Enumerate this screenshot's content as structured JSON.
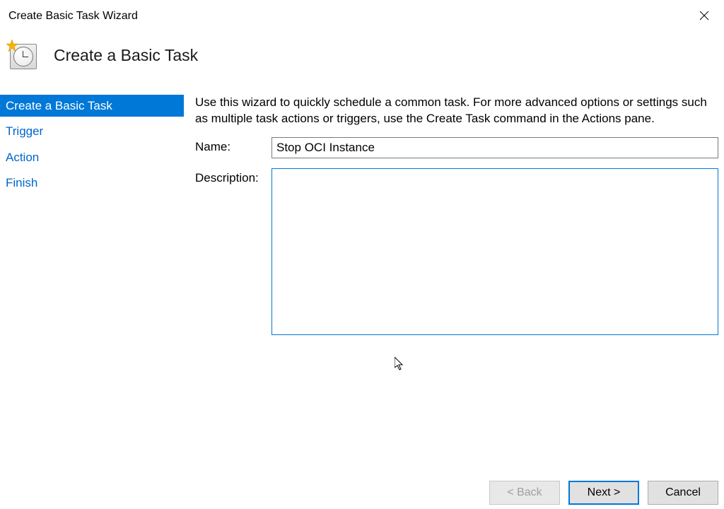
{
  "window": {
    "title": "Create Basic Task Wizard"
  },
  "header": {
    "title": "Create a Basic Task"
  },
  "sidebar": {
    "items": [
      {
        "label": "Create a Basic Task",
        "selected": true
      },
      {
        "label": "Trigger",
        "selected": false
      },
      {
        "label": "Action",
        "selected": false
      },
      {
        "label": "Finish",
        "selected": false
      }
    ]
  },
  "main": {
    "intro": "Use this wizard to quickly schedule a common task.  For more advanced options or settings such as multiple task actions or triggers, use the Create Task command in the Actions pane.",
    "name_label": "Name:",
    "name_value": "Stop OCI Instance",
    "description_label": "Description:",
    "description_value": ""
  },
  "buttons": {
    "back": "< Back",
    "next": "Next >",
    "cancel": "Cancel"
  }
}
